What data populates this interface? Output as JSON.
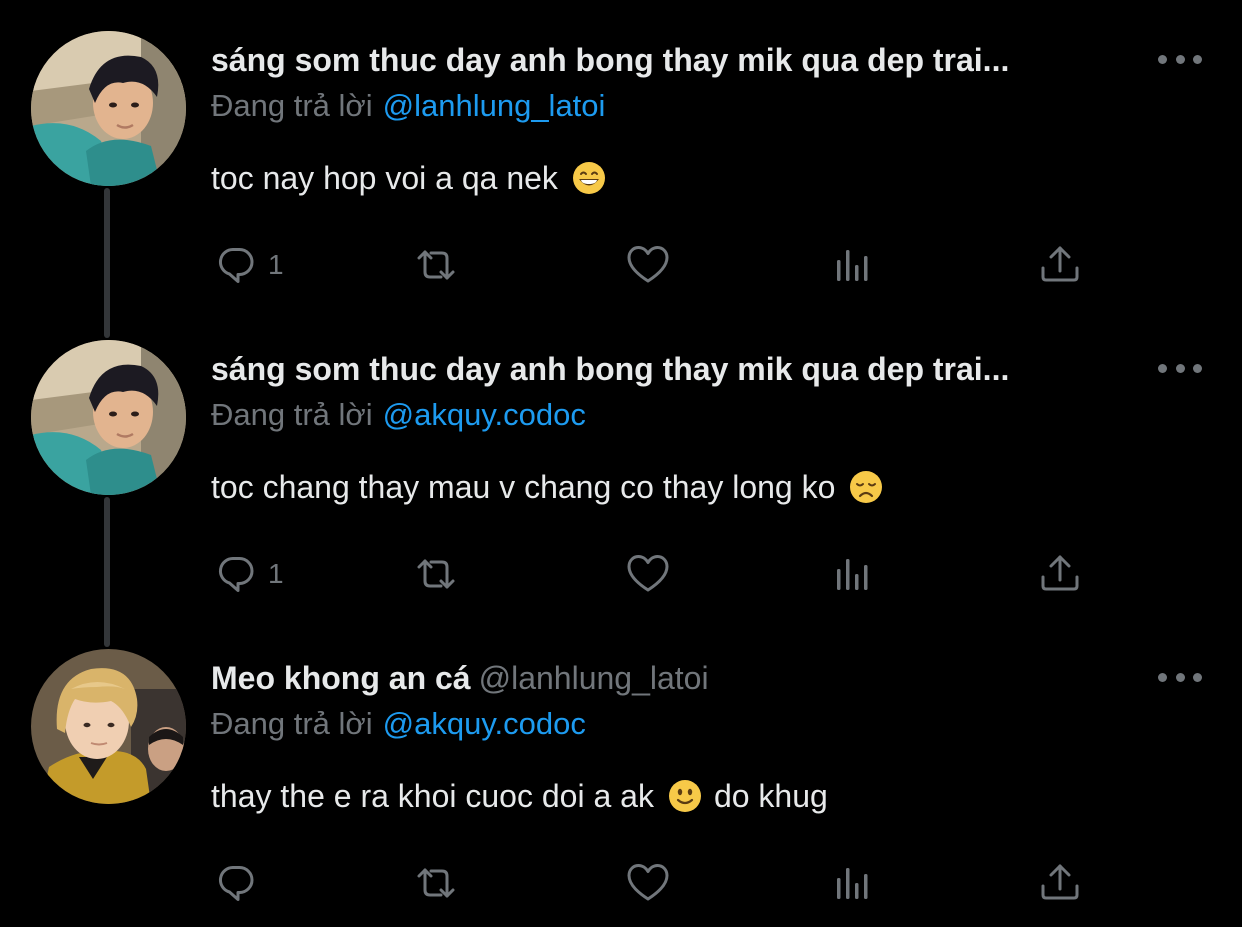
{
  "tweets": [
    {
      "name": "sáng som thuc day anh bong thay mik qua dep trai...",
      "handle": "",
      "reply_label": "Đang trả lời",
      "reply_to": "@lanhlung_latoi",
      "text": "toc nay hop voi a qa nek",
      "text_after_emoji": "",
      "emoji": "grinning-face",
      "reply_count": "1",
      "avatar": "boy-selfie"
    },
    {
      "name": "sáng som thuc day anh bong thay mik qua dep trai...",
      "handle": "",
      "reply_label": "Đang trả lời",
      "reply_to": "@akquy.codoc",
      "text": "toc chang thay mau v chang co thay long ko",
      "text_after_emoji": "",
      "emoji": "disappointed-face",
      "reply_count": "1",
      "avatar": "boy-selfie"
    },
    {
      "name": "Meo khong an cá",
      "handle": "@lanhlung_latoi",
      "reply_label": "Đang trả lời",
      "reply_to": "@akquy.codoc",
      "text": "thay the e ra khoi cuoc doi a ak",
      "text_after_emoji": "do khug",
      "emoji": "slightly-smiling-face",
      "reply_count": "",
      "avatar": "blond-boy-uniform"
    }
  ],
  "colors": {
    "background": "#000000",
    "text": "#e7e9ea",
    "muted": "#71767b",
    "mention": "#1d9bf0",
    "thread_line": "#333639"
  }
}
